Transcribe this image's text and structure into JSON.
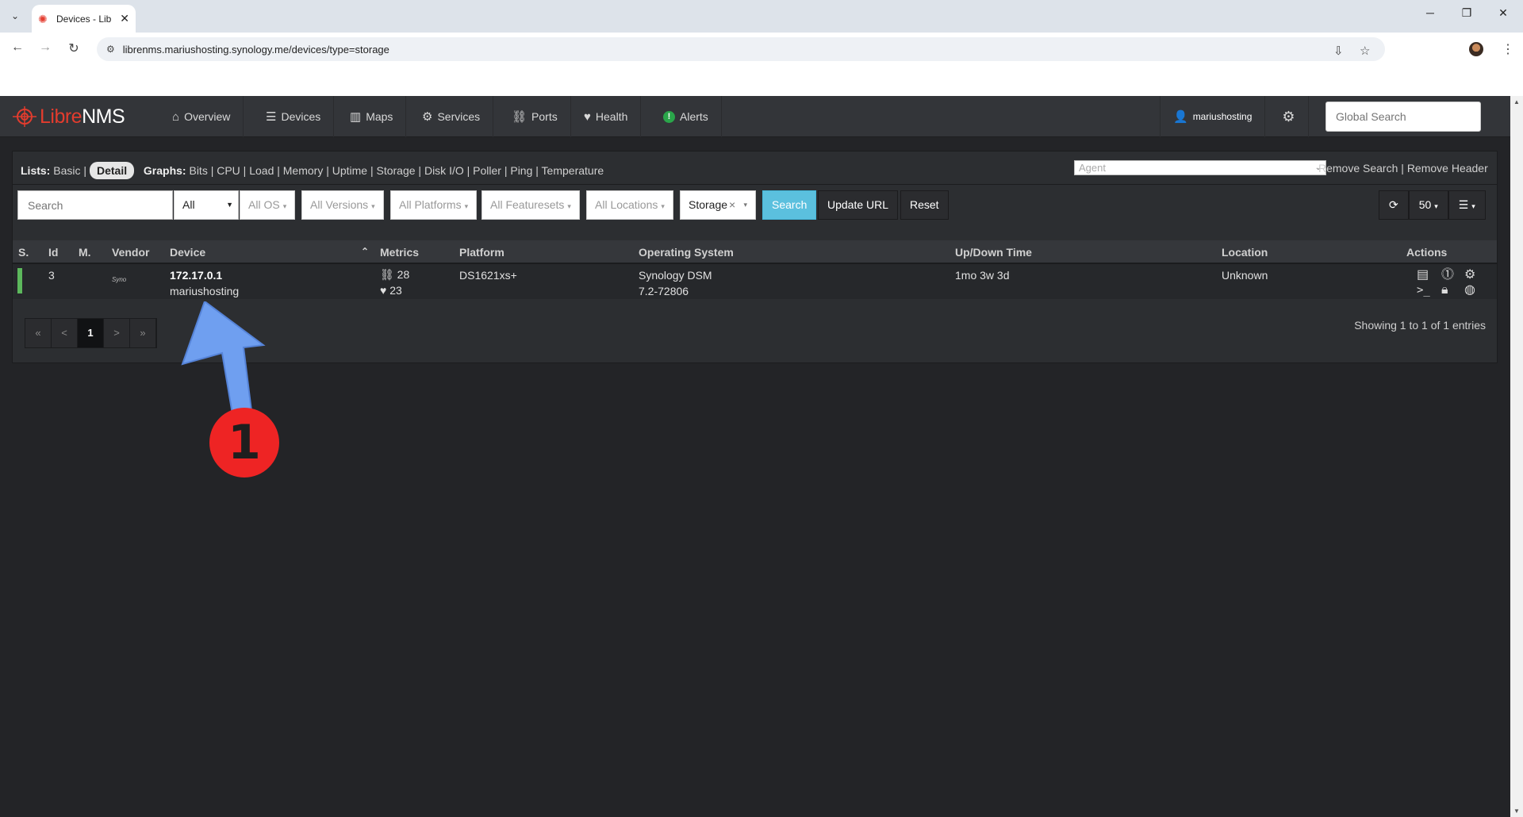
{
  "browser": {
    "tab_title": "Devices - Lib",
    "url": "librenms.mariushosting.synology.me/devices/type=storage"
  },
  "navbar": {
    "brand_left": "Libre",
    "brand_right": "NMS",
    "menu": [
      {
        "label": "Overview",
        "icon": "home-icon"
      },
      {
        "label": "Devices",
        "icon": "server-icon"
      },
      {
        "label": "Maps",
        "icon": "map-icon"
      },
      {
        "label": "Services",
        "icon": "cogs-icon"
      },
      {
        "label": "Ports",
        "icon": "link-icon"
      },
      {
        "label": "Health",
        "icon": "heartbeat-icon"
      },
      {
        "label": "Alerts",
        "icon": "alert-icon"
      }
    ],
    "user": "mariushosting",
    "global_search_placeholder": "Global Search"
  },
  "lists_bar": {
    "lists_label": "Lists:",
    "basic": "Basic",
    "detail": "Detail",
    "graphs_label": "Graphs:",
    "graphs": "Bits | CPU | Load | Memory | Uptime | Storage | Disk I/O | Poller | Ping | Temperature",
    "agent_placeholder": "Agent",
    "remove_search": "Remove Search",
    "remove_header": "Remove Header"
  },
  "filters": {
    "search_placeholder": "Search",
    "all": "All",
    "os": "All OS",
    "versions": "All Versions",
    "platforms": "All Platforms",
    "featuresets": "All Featuresets",
    "locations": "All Locations",
    "type": "Storage",
    "search_btn": "Search",
    "update_url_btn": "Update URL",
    "reset_btn": "Reset",
    "per_page": "50"
  },
  "table": {
    "headers": {
      "status": "S.",
      "id": "Id",
      "maintenance": "M.",
      "vendor": "Vendor",
      "device": "Device",
      "metrics": "Metrics",
      "platform": "Platform",
      "os": "Operating System",
      "uptime": "Up/Down Time",
      "location": "Location",
      "actions": "Actions"
    },
    "rows": [
      {
        "id": "3",
        "vendor": "Syno",
        "device_ip": "172.17.0.1",
        "device_name": "mariushosting",
        "ports": "28",
        "sensors": "23",
        "platform": "DS1621xs+",
        "os": "Synology DSM",
        "os_version": "7.2-72806",
        "uptime": "1mo 3w 3d",
        "location": "Unknown",
        "status_color": "#5cb85c"
      }
    ],
    "current_page": "1",
    "entries_text": "Showing 1 to 1 of 1 entries"
  },
  "annotation": {
    "badge": "1",
    "color": "#ee2424",
    "arrow_color": "#6f9ff0"
  }
}
